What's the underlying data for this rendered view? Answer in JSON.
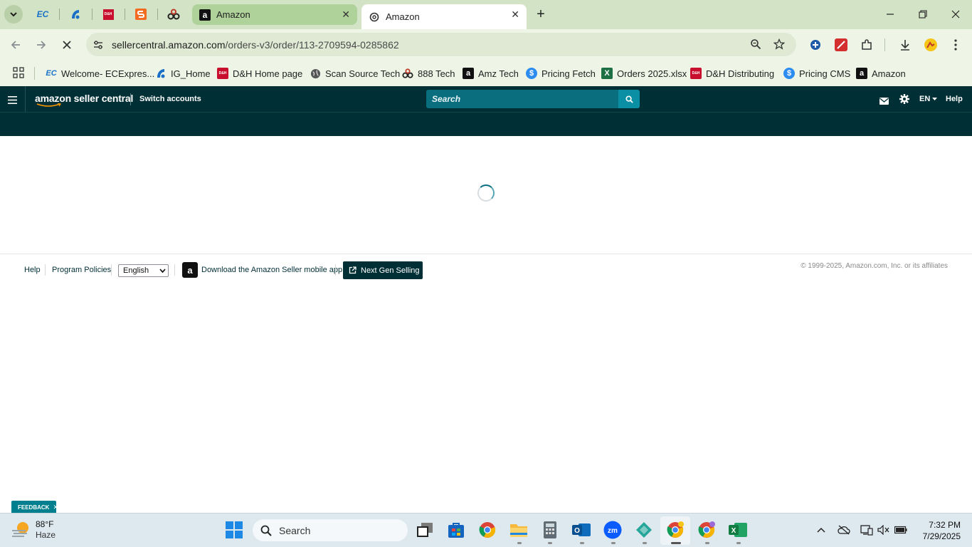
{
  "browser": {
    "pinned_tabs": [
      {
        "icon": "ecexpress-icon",
        "label": "EC"
      },
      {
        "icon": "ig-icon",
        "label": ""
      },
      {
        "icon": "dh-icon",
        "label": "D&H"
      },
      {
        "icon": "scansource-icon",
        "label": ""
      },
      {
        "icon": "888-icon",
        "label": ""
      }
    ],
    "tabs": [
      {
        "title": "Amazon",
        "active": false
      },
      {
        "title": "Amazon",
        "active": true
      }
    ],
    "new_tab_label": "+",
    "url_domain": "sellercentral.amazon.com",
    "url_path": "/orders-v3/order/113-2709594-0285862",
    "bookmarks": [
      {
        "label": "Welcome- ECExpres...",
        "icon": "ecexpress-icon"
      },
      {
        "label": "IG_Home",
        "icon": "ig-icon"
      },
      {
        "label": "D&H Home page",
        "icon": "dh-icon"
      },
      {
        "label": "Scan Source Tech",
        "icon": "globe-icon"
      },
      {
        "label": "888 Tech",
        "icon": "888-icon"
      },
      {
        "label": "Amz Tech",
        "icon": "amazon-icon"
      },
      {
        "label": "Pricing Fetch",
        "icon": "dollar-icon"
      },
      {
        "label": "Orders 2025.xlsx",
        "icon": "excel-icon"
      },
      {
        "label": "D&H Distributing",
        "icon": "dh-icon"
      },
      {
        "label": "Pricing CMS",
        "icon": "dollar-icon"
      },
      {
        "label": "Amazon",
        "icon": "amazon-icon"
      }
    ]
  },
  "seller_central": {
    "logo_text": "amazon seller central",
    "switch_accounts": "Switch accounts",
    "search_placeholder": "Search",
    "language": "EN",
    "help": "Help"
  },
  "footer": {
    "help": "Help",
    "program_policies": "Program Policies",
    "language_selected": "English",
    "download_app": "Download the Amazon Seller mobile app",
    "next_gen": "Next Gen Selling",
    "copyright": "© 1999-2025, Amazon.com, Inc. or its affiliates"
  },
  "feedback_label": "FEEDBACK",
  "taskbar": {
    "weather_temp": "88°F",
    "weather_desc": "Haze",
    "search_placeholder": "Search",
    "time": "7:32 PM",
    "date": "7/29/2025"
  }
}
